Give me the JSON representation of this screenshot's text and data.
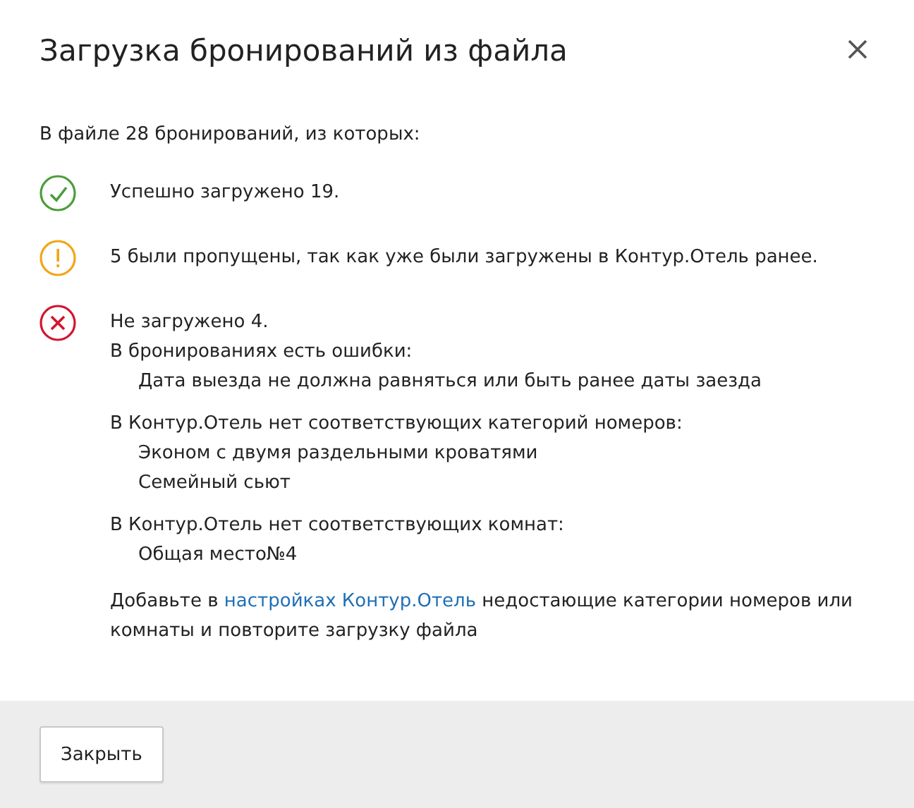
{
  "dialog": {
    "title": "Загрузка бронирований из файла"
  },
  "summary": "В файле 28 бронирований, из которых:",
  "results": [
    {
      "kind": "success",
      "text": "Успешно загружено 19."
    },
    {
      "kind": "warning",
      "text": "5 были пропущены, так как уже были загружены в Контур.Отель ранее."
    },
    {
      "kind": "error",
      "text": "Не загружено 4.",
      "groups": [
        {
          "heading": "В бронированиях есть ошибки:",
          "items": [
            "Дата выезда не должна равняться или быть ранее даты заезда"
          ]
        },
        {
          "heading": "В Контур.Отель нет соответствующих категорий номеров:",
          "items": [
            "Эконом с двумя раздельными кроватями",
            "Семейный сьют"
          ]
        },
        {
          "heading": "В Контур.Отель нет соответствующих комнат:",
          "items": [
            "Общая место№4"
          ]
        }
      ]
    }
  ],
  "note": {
    "before": "Добавьте в ",
    "link": "настройках Контур.Отель",
    "after": " недостающие категории номеров или комнаты и повторите загрузку файла"
  },
  "buttons": [
    {
      "label": "Закрыть"
    }
  ]
}
